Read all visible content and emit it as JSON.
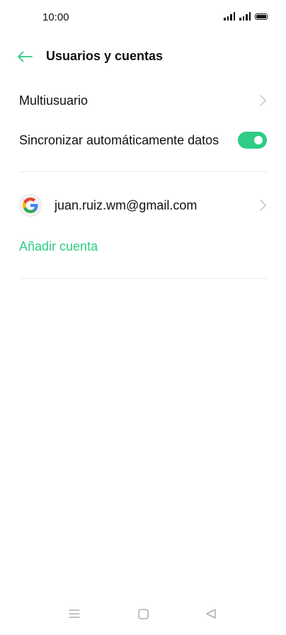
{
  "status_bar": {
    "time": "10:00"
  },
  "header": {
    "title": "Usuarios y cuentas",
    "back_icon": "arrow-left-icon"
  },
  "settings": {
    "multiuser_label": "Multiusuario",
    "sync_label": "Sincronizar automáticamente datos",
    "sync_enabled": true
  },
  "accounts": [
    {
      "email": "juan.ruiz.wm@gmail.com",
      "icon": "google-icon"
    }
  ],
  "add_account_label": "Añadir cuenta",
  "colors": {
    "accent": "#2ecc85",
    "text": "#111111",
    "chevron": "#c8c8c8",
    "divider": "#ececec",
    "nav_icon": "#a0a0a0"
  }
}
